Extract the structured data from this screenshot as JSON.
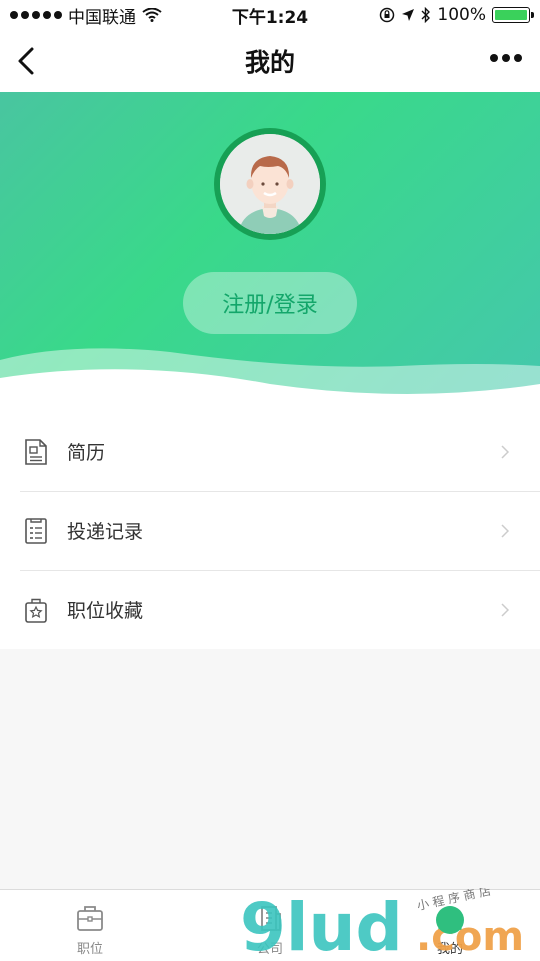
{
  "status_bar": {
    "carrier": "中国联通",
    "time": "下午1:24",
    "battery": "100%"
  },
  "nav": {
    "title": "我的"
  },
  "profile": {
    "login_label": "注册/登录"
  },
  "menu": {
    "items": [
      {
        "label": "简历",
        "icon": "resume-icon"
      },
      {
        "label": "投递记录",
        "icon": "delivery-record-icon"
      },
      {
        "label": "职位收藏",
        "icon": "favorite-bag-icon"
      }
    ]
  },
  "tabbar": {
    "tabs": [
      {
        "label": "职位",
        "icon": "briefcase-icon",
        "active": false
      },
      {
        "label": "公司",
        "icon": "building-icon",
        "active": false
      },
      {
        "label": "我的",
        "icon": "user-icon",
        "active": true
      }
    ]
  },
  "watermark": {
    "brand": "9lud",
    "domain": ".com",
    "tagline": "小 程 序 商 店"
  },
  "colors": {
    "accent": "#39d98a",
    "login_text": "#13a66a",
    "avatar_ring": "#17a055"
  }
}
